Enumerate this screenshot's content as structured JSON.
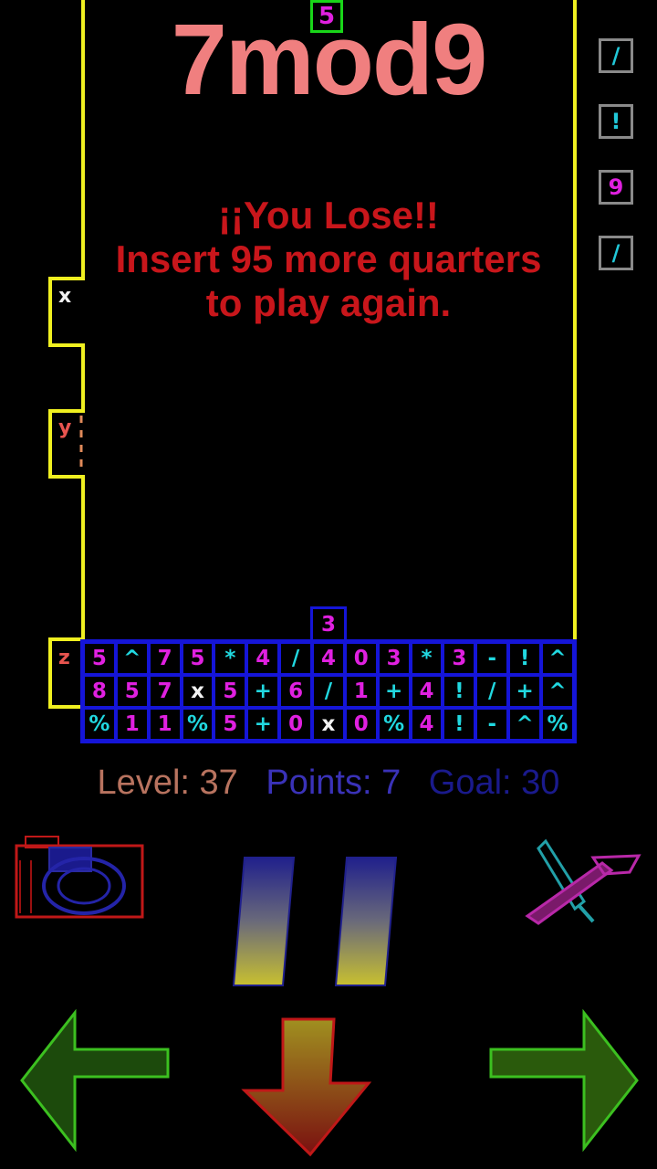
{
  "game": {
    "title": "7mod9",
    "falling_tile": "5",
    "message_line1": "¡¡You Lose!!",
    "message_line2": "Insert 95 more quarters",
    "message_line3": "to play again."
  },
  "queue": [
    {
      "symbol": "/",
      "color": "#21c8d8"
    },
    {
      "symbol": "!",
      "color": "#21c8d8"
    },
    {
      "symbol": "9",
      "color": "#e020e0"
    },
    {
      "symbol": "/",
      "color": "#21c8d8"
    }
  ],
  "variables": {
    "x": "x",
    "y": "y",
    "z": "z"
  },
  "grid_top_tile": "3",
  "grid": [
    [
      "5",
      "^",
      "7",
      "5",
      "*",
      "4",
      "/",
      "4",
      "0",
      "3",
      "*",
      "3",
      "-",
      "!",
      "^"
    ],
    [
      "8",
      "5",
      "7",
      "x",
      "5",
      "+",
      "6",
      "/",
      "1",
      "+",
      "4",
      "!",
      "/",
      "+",
      "^"
    ],
    [
      "%",
      "1",
      "1",
      "%",
      "5",
      "+",
      "0",
      "x",
      "0",
      "%",
      "4",
      "!",
      "-",
      "^",
      "%"
    ]
  ],
  "colors": {
    "digit": "#e020e0",
    "operator": "#21d8e0",
    "variable": "#f2f2f2",
    "level": "#b8735f",
    "points": "#3a32b8",
    "goal": "#1a1a8c",
    "field_border": "#f0f020",
    "grid_border": "#1515d8"
  },
  "stats": {
    "level": "Level: 37",
    "points": "Points: 7",
    "goal": "Goal: 30"
  },
  "controls": [
    "camera-icon",
    "pause-icon",
    "tools-icon",
    "left-arrow-icon",
    "down-arrow-icon",
    "right-arrow-icon"
  ]
}
